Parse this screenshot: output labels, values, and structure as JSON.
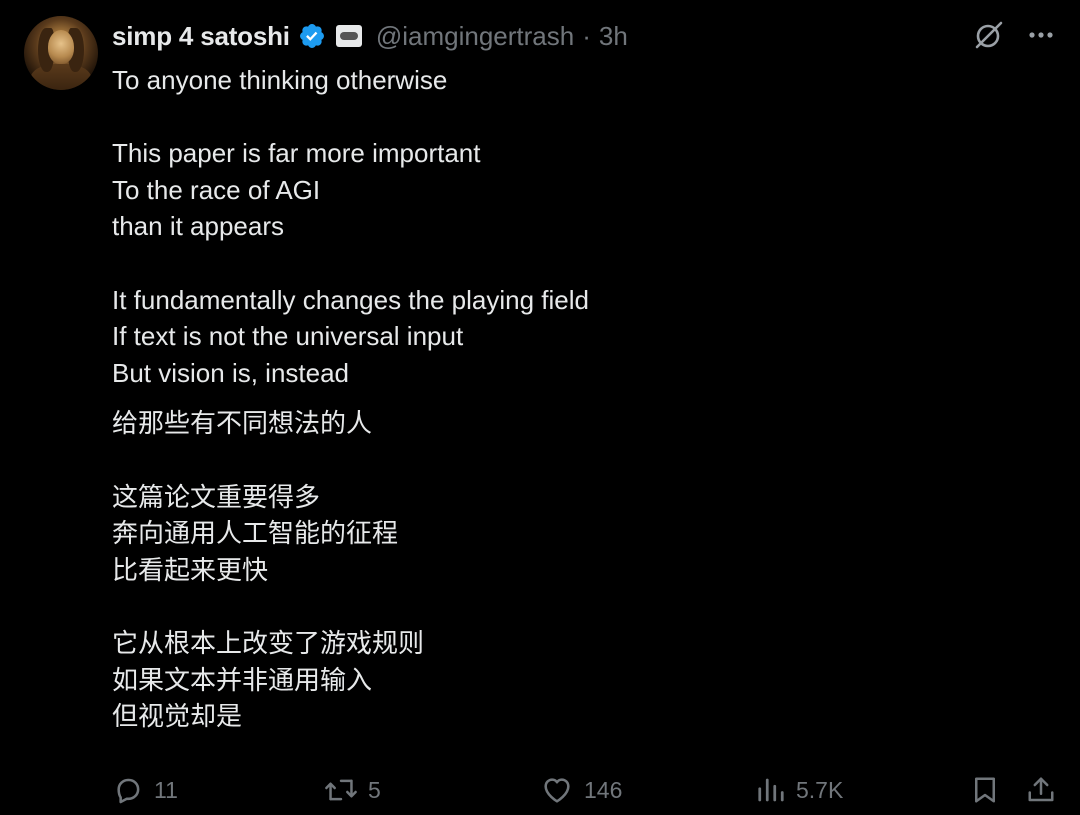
{
  "author": {
    "display_name": "simp 4 satoshi",
    "handle": "@iamgingertrash",
    "separator": "·",
    "time": "3h",
    "verified_icon": "verified-badge-icon",
    "affiliate_icon": "affiliate-badge-icon"
  },
  "top_actions": {
    "grok_icon": "grok-icon",
    "more_icon": "more-icon"
  },
  "tweet": {
    "english": [
      "To anyone thinking otherwise",
      "",
      "This paper is far more important",
      "To the race of AGI",
      "than it appears",
      "",
      "It fundamentally changes the playing field",
      "If text is not the universal input",
      "But vision is, instead"
    ],
    "chinese": [
      "给那些有不同想法的人",
      "",
      "这篇论文重要得多",
      "奔向通用人工智能的征程",
      "比看起来更快",
      "",
      "它从根本上改变了游戏规则",
      "如果文本并非通用输入",
      "但视觉却是"
    ]
  },
  "actions": {
    "reply": {
      "count": "11",
      "icon": "reply-icon"
    },
    "retweet": {
      "count": "5",
      "icon": "retweet-icon"
    },
    "like": {
      "count": "146",
      "icon": "heart-icon"
    },
    "views": {
      "count": "5.7K",
      "icon": "views-icon"
    },
    "bookmark": {
      "icon": "bookmark-icon"
    },
    "share": {
      "icon": "share-icon"
    }
  },
  "colors": {
    "background": "#000000",
    "text": "#e7e9ea",
    "muted": "#71767b",
    "verified": "#1d9bf0"
  }
}
